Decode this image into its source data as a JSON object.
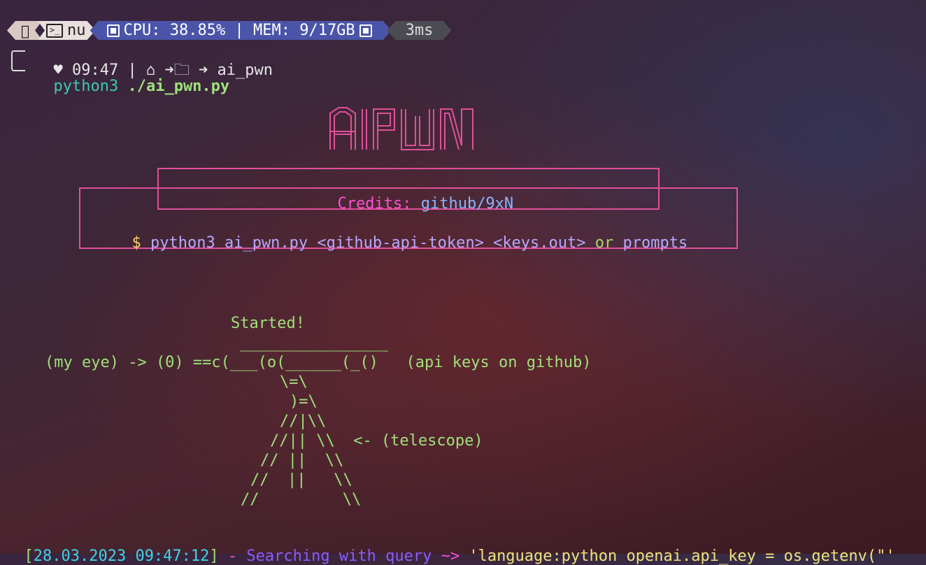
{
  "prompt": {
    "shell": "nu",
    "cpu_mem": "CPU: 38.85% | MEM: 9/17GB",
    "duration": "3ms",
    "clock": "09:47",
    "path_sep": "|",
    "cwd": "ai_pwn",
    "command_bin": "python3",
    "command_arg": "./ai_pwn.py"
  },
  "banner": {
    "logo_text": "AI PWN",
    "credits_label": "Credits:",
    "credits_value": "github/9xN",
    "usage_dollar": "$",
    "usage_cmd": "python3 ai_pwn.py <github-api-token> <keys.out>",
    "usage_or": "or",
    "usage_alt": "prompts"
  },
  "ascii_art": {
    "started": "Started!",
    "line1": " ________________",
    "line2": "(my eye) -> (0) ==c(___(o(______(_()   (api keys on github)",
    "line3": "\\=\\",
    "line4": ")=\\",
    "line5": "//|\\\\",
    "line6": "//|| \\\\  <- (telescope)",
    "line7": "// ||  \\\\",
    "line8": "//  ||   \\\\",
    "line9": "//         \\\\"
  },
  "log": {
    "open_bracket": "[",
    "timestamp": "28.03.2023 09:47:12",
    "close_bracket": "]",
    "dash": "-",
    "message": "Searching with query",
    "arrow": "~>",
    "query": "'language:python openai.api_key = os.getenv(\"'"
  },
  "colors": {
    "accent_pink": "#e0509a",
    "powerline_blue": "#4a54a8",
    "green": "#9ee27a",
    "cyan": "#3fd3e8"
  }
}
